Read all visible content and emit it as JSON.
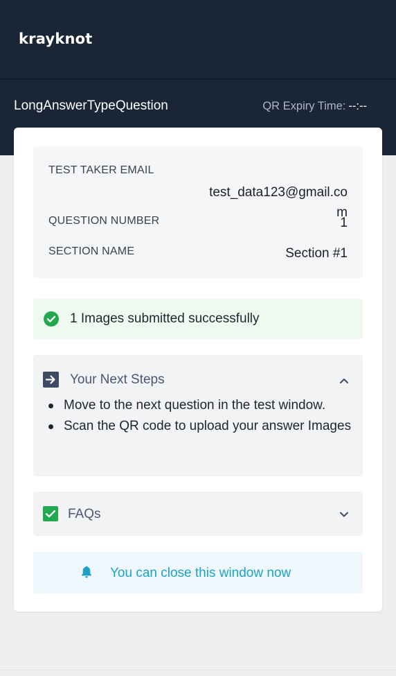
{
  "header": {
    "logo_text": "krayknot",
    "question_type": "LongAnswerTypeQuestion",
    "qr_expiry_label": "QR Expiry Time:",
    "qr_expiry_value": "--:--"
  },
  "info": {
    "email_label": "TEST TAKER EMAIL",
    "email_value": "test_data123@gmail.com",
    "question_number_label": "QUESTION NUMBER",
    "question_number_value": "1",
    "section_name_label": "SECTION NAME",
    "section_name_value": "Section #1"
  },
  "status": {
    "success_text": "1 Images submitted successfully",
    "success_color": "#22a94f"
  },
  "next_steps": {
    "title": "Your Next Steps",
    "expanded": true,
    "items": [
      "Move to the next question in the test window.",
      "Scan the QR code to upload your answer Images"
    ]
  },
  "faqs": {
    "title": "FAQs",
    "expanded": false
  },
  "notice": {
    "text": "You can close this window now",
    "color": "#1ba3c6"
  },
  "icons": {
    "success": "check-circle-icon",
    "next_steps": "arrow-right-square-icon",
    "faqs": "check-square-icon",
    "notice": "bell-icon",
    "expand": "chevron-up-icon",
    "collapse": "chevron-down-icon"
  },
  "colors": {
    "header_bg": "#1a2536",
    "page_bg": "#efefef",
    "card_bg": "#ffffff"
  }
}
